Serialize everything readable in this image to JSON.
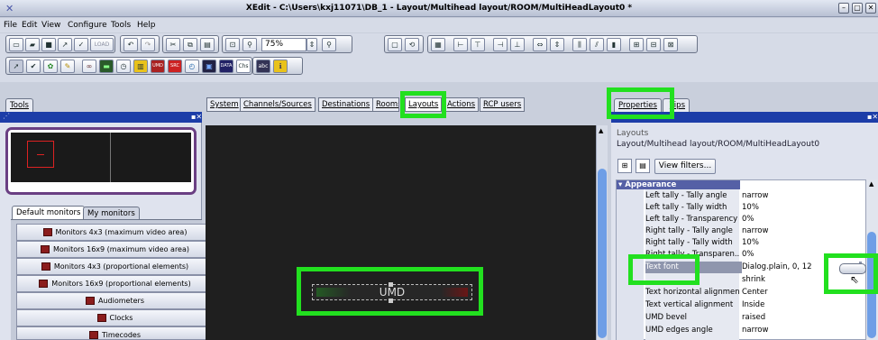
{
  "window": {
    "title": "XEdit - C:\\Users\\kxj11071\\DB_1 - Layout/Multihead layout/ROOM/MultiHeadLayout0 *"
  },
  "menu": [
    "File",
    "Edit",
    "View",
    "Configure",
    "Tools",
    "Help"
  ],
  "toolbar": {
    "load_label": "LOAD",
    "zoom_value": "75%"
  },
  "tools_panel": {
    "tab_label": "Tools",
    "monitor_tabs": [
      "Default monitors",
      "My monitors"
    ],
    "items": [
      "Monitors 4x3 (maximum video area)",
      "Monitors 16x9 (maximum video area)",
      "Monitors 4x3 (proportional elements)",
      "Monitors 16x9 (proportional elements)",
      "Audiometers",
      "Clocks",
      "Timecodes"
    ]
  },
  "center_tabs": [
    "System",
    "Channels/Sources",
    "Destinations",
    "Rooms",
    "Layouts",
    "Actions",
    "RCP users"
  ],
  "canvas": {
    "umd_label": "UMD"
  },
  "properties": {
    "tabs": [
      "Properties",
      "Tips"
    ],
    "header_label": "Layouts",
    "path": "Layout/Multihead layout/ROOM/MultiHeadLayout0",
    "view_filters_label": "View filters...",
    "section": "Appearance",
    "rows": [
      {
        "key": "Left tally - Tally angle",
        "value": "narrow"
      },
      {
        "key": "Left tally - Tally width",
        "value": "10%"
      },
      {
        "key": "Left tally - Transparency",
        "value": "0%"
      },
      {
        "key": "Right tally - Tally angle",
        "value": "narrow"
      },
      {
        "key": "Right tally - Tally width",
        "value": "10%"
      },
      {
        "key": "Right tally - Transparen...",
        "value": "0%"
      },
      {
        "key": "Text font",
        "value": "Dialog.plain, 0, 12"
      },
      {
        "key": "",
        "value": "shrink"
      },
      {
        "key": "Text horizontal alignment",
        "value": "Center"
      },
      {
        "key": "Text vertical alignment",
        "value": "Inside"
      },
      {
        "key": "UMD bevel",
        "value": "raised"
      },
      {
        "key": "UMD edges angle",
        "value": "narrow"
      }
    ]
  },
  "colors": {
    "highlight": "#22e01f",
    "panel_band": "#1c3da8",
    "canvas_bg": "#1f1f1f"
  }
}
